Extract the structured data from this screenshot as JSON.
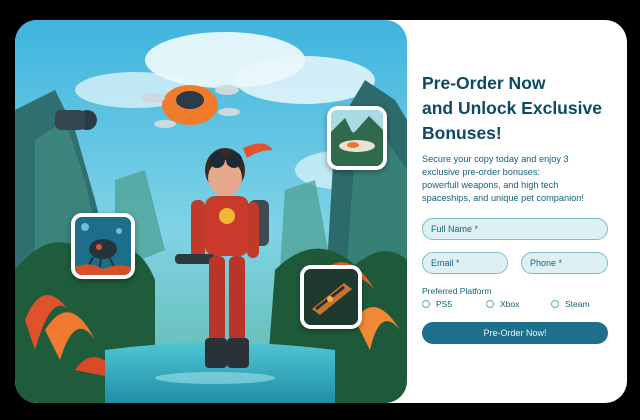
{
  "hero": {
    "thumbnails": [
      {
        "subject": "spaceship-over-jungle"
      },
      {
        "subject": "robot-creature-underwater"
      },
      {
        "subject": "weapon-closeup"
      }
    ]
  },
  "form": {
    "title_line1": "Pre-Order Now",
    "title_line2": "and Unlock Exclusive",
    "title_line3": "Bonuses!",
    "desc_line1": "Secure your copy today and enjoy 3",
    "desc_line2": "exclusive pre-order bonuses:",
    "desc_line3": "powerfull weapons, and high tech",
    "desc_line4": "spaceships, and unique pet companion!",
    "full_name_placeholder": "Full Name *",
    "email_placeholder": "Email *",
    "phone_placeholder": "Phone *",
    "platform_label": "Preferred Platform",
    "platforms": [
      "PS5",
      "Xbox",
      "Steam"
    ],
    "submit_label": "Pre-Order Now!"
  },
  "colors": {
    "title": "#0d4a63",
    "accent": "#1d6f8c",
    "field_bg": "#dff0f5",
    "field_border": "#7cbccb"
  }
}
